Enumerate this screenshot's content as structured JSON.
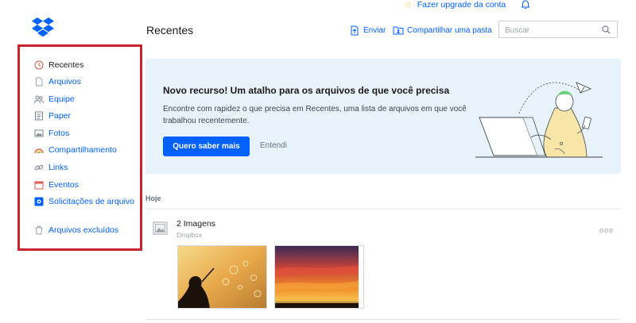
{
  "topbar": {
    "upgrade_label": "Fazer upgrade da conta"
  },
  "sidebar": {
    "items": [
      {
        "label": "Recentes",
        "icon": "clock-icon"
      },
      {
        "label": "Arquivos",
        "icon": "file-icon"
      },
      {
        "label": "Equipe",
        "icon": "team-icon"
      },
      {
        "label": "Paper",
        "icon": "paper-icon"
      },
      {
        "label": "Fotos",
        "icon": "photo-icon"
      },
      {
        "label": "Compartilhamento",
        "icon": "sharing-icon"
      },
      {
        "label": "Links",
        "icon": "link-icon"
      },
      {
        "label": "Eventos",
        "icon": "calendar-icon"
      },
      {
        "label": "Solicitações de arquivo",
        "icon": "file-request-icon"
      },
      {
        "label": "Arquivos excluídos",
        "icon": "trash-icon"
      }
    ]
  },
  "header": {
    "title": "Recentes",
    "upload_label": "Enviar",
    "share_folder_label": "Compartilhar uma pasta",
    "search_placeholder": "Buscar"
  },
  "banner": {
    "title": "Novo recurso! Um atalho para os arquivos de que você precisa",
    "text": "Encontre com rapidez o que precisa em Recentes, uma lista de arquivos em que você trabalhou recentemente.",
    "primary_label": "Quero saber mais",
    "dismiss_label": "Entendi"
  },
  "recent": {
    "section_label": "Hoje",
    "item": {
      "title": "2 Imagens",
      "location": "Dropbox",
      "more_label": "ooo"
    }
  },
  "colors": {
    "accent": "#0061fe",
    "highlight_border": "#c8232c",
    "banner_bg": "#e7f2fb"
  }
}
